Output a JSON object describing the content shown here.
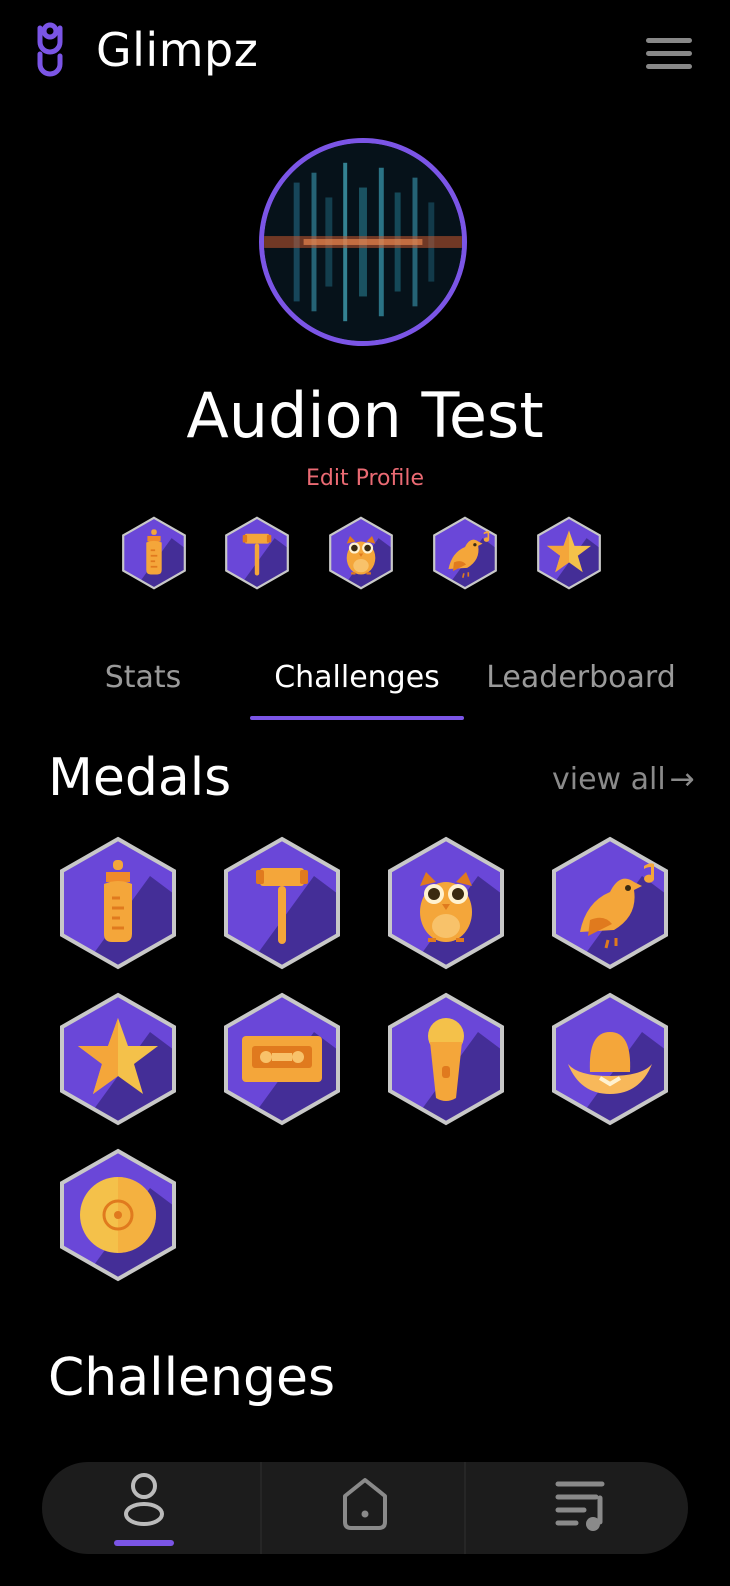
{
  "app": {
    "title": "Glimpz"
  },
  "profile": {
    "name": "Audion Test",
    "edit_label": "Edit Profile"
  },
  "tabs": [
    {
      "label": "Stats",
      "active": false
    },
    {
      "label": "Challenges",
      "active": true
    },
    {
      "label": "Leaderboard",
      "active": false
    }
  ],
  "medals_section": {
    "title": "Medals",
    "view_all_label": "view all",
    "view_all_arrow": "→"
  },
  "badges_preview": [
    "baby-bottle-icon",
    "gavel-icon",
    "owl-icon",
    "singing-bird-icon",
    "star-icon"
  ],
  "medals": [
    "baby-bottle-icon",
    "gavel-icon",
    "owl-icon",
    "singing-bird-icon",
    "star-icon",
    "cassette-tape-icon",
    "microphone-icon",
    "cowboy-hat-icon",
    "vinyl-record-icon"
  ],
  "challenges_section": {
    "title": "Challenges"
  },
  "bottom_nav": {
    "items": [
      "profile-icon",
      "home-icon",
      "playlist-icon"
    ],
    "active": "profile-icon"
  },
  "colors": {
    "accent": "#7b55e6",
    "hex_fill": "#6a47d8",
    "hex_shadow": "#3d2a8c",
    "hex_border": "#c8c8c8",
    "icon": "#f4a63a",
    "edit_profile": "#ea6a73"
  }
}
